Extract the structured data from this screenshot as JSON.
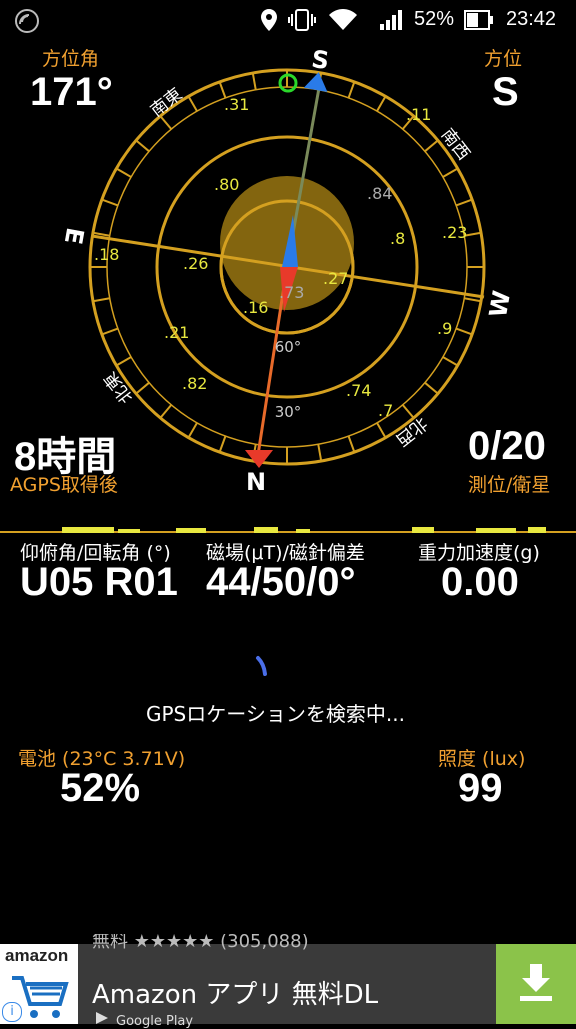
{
  "status_bar": {
    "battery_percent": "52%",
    "time": "23:42",
    "icons": [
      "alert-icon",
      "location-icon",
      "vibrate-icon",
      "wifi-icon",
      "signal-icon",
      "battery-icon"
    ]
  },
  "compass": {
    "azimuth_label": "方位角",
    "azimuth_value": "171°",
    "direction_label": "方位",
    "direction_value": "S",
    "cardinals": {
      "N": "N",
      "S": "S",
      "E": "E",
      "W": "W"
    },
    "intercardinals": {
      "se": "南東",
      "sw": "南西",
      "ne": "北東",
      "nw": "北西"
    },
    "elevation_rings": [
      "30°",
      "60°"
    ],
    "satellites": [
      ".31",
      ".11",
      ".80",
      ".84",
      ".8",
      ".23",
      ".18",
      ".26",
      ".27",
      ".73",
      ".16",
      ".9",
      ".21",
      ".82",
      ".74",
      ".7"
    ],
    "colors": {
      "ring": "#d4a020",
      "needle_north": "#e83a2a",
      "needle_south": "#2a7be8",
      "satellite_label": "#e8e840",
      "satellite_label_gray": "#aaaaaa"
    }
  },
  "time_block": {
    "value": "8時間",
    "label": "AGPS取得後"
  },
  "sat_block": {
    "value": "0/20",
    "label": "測位/衛星"
  },
  "sensors": [
    {
      "label": "仰俯角/回転角 (°)",
      "value": "U05 R01"
    },
    {
      "label": "磁場(μT)/磁針偏差",
      "value": "44/50/0°"
    },
    {
      "label": "重力加速度(g)",
      "value": "0.00"
    }
  ],
  "gps_status": "GPSロケーションを検索中...",
  "battery": {
    "label": "電池 (23°C 3.71V)",
    "value": "52%"
  },
  "lux": {
    "label": "照度 (lux)",
    "value": "99"
  },
  "ad": {
    "brand": "amazon",
    "title": "Amazon アプリ 無料DL",
    "top_partial": "無料 ★★★★★ (305,088)",
    "store": "Google Play",
    "info_icon": "info-icon",
    "download_icon": "download-icon"
  }
}
